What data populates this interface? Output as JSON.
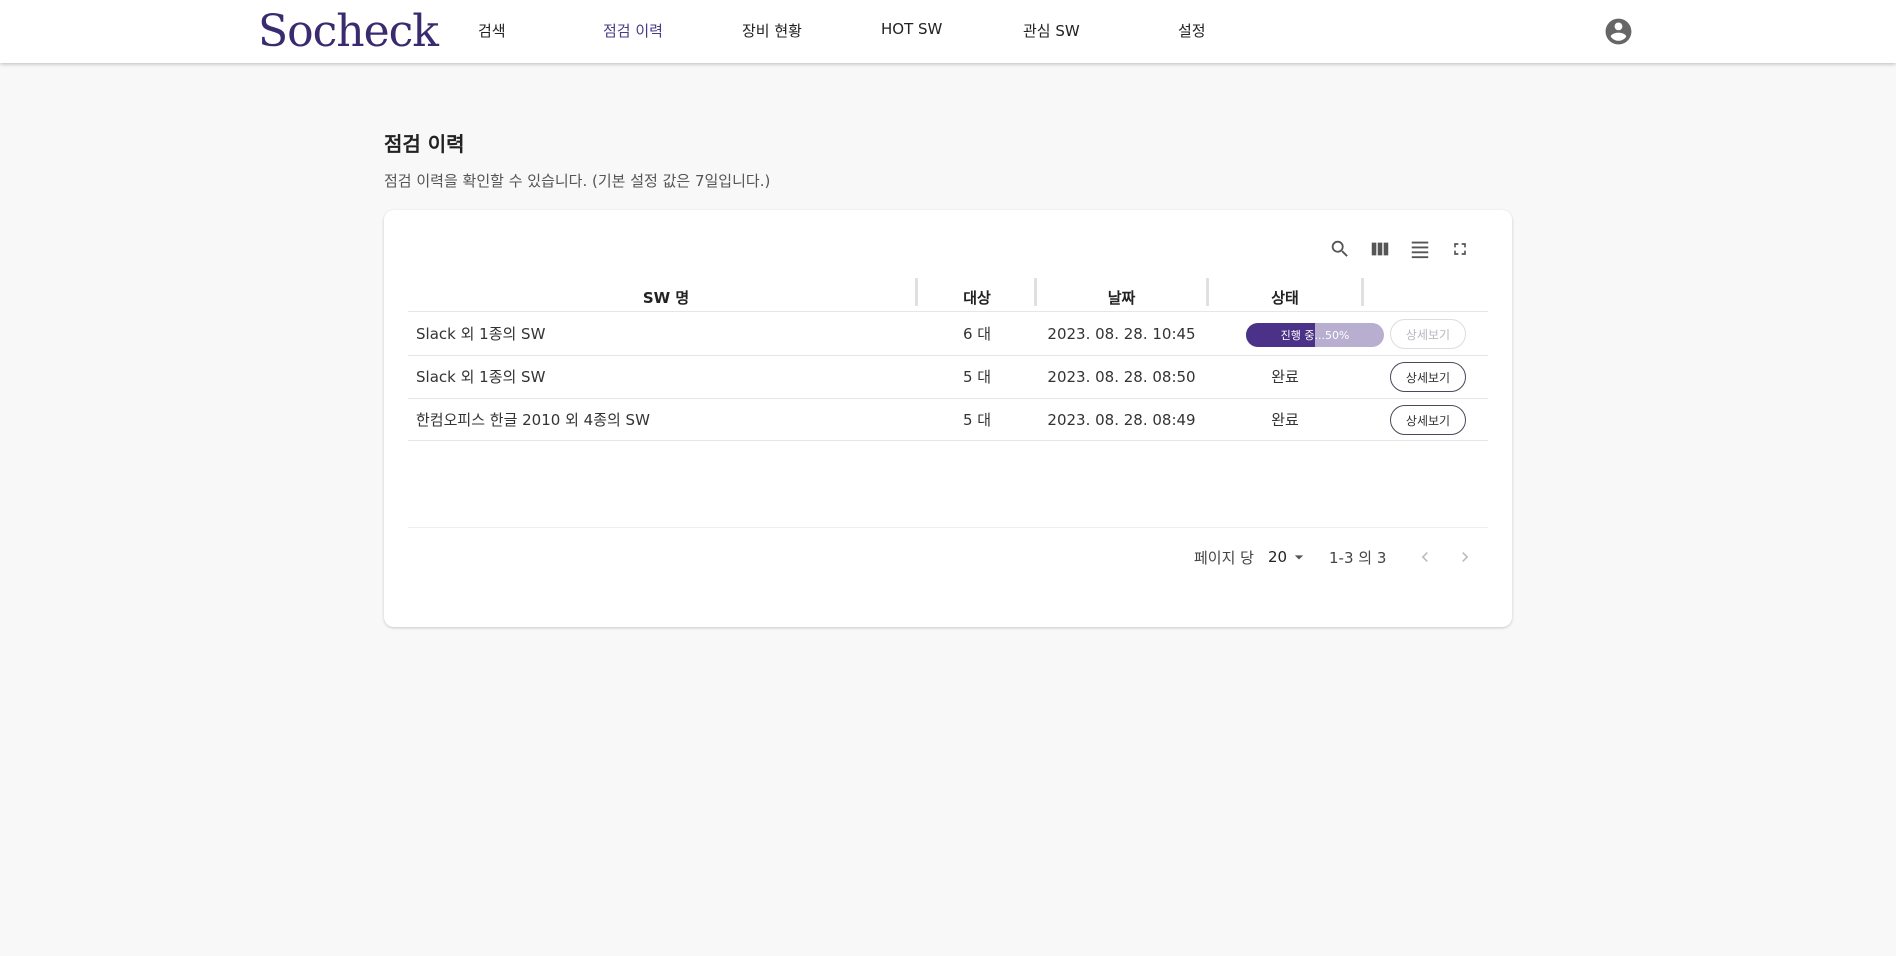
{
  "header": {
    "logo_text": "Socheck",
    "nav": [
      {
        "label": "검색"
      },
      {
        "label": "점검 이력"
      },
      {
        "label": "장비 현황"
      },
      {
        "label": "HOT SW"
      },
      {
        "label": "관심 SW"
      },
      {
        "label": "설정"
      }
    ],
    "active_index": 1,
    "account_icon": "account-circle-icon"
  },
  "main": {
    "title": "점검 이력",
    "description": "점검 이력을 확인할 수 있습니다. (기본 설정 값은 7일입니다.)"
  },
  "table": {
    "toolbar_icons": [
      "search-icon",
      "columns-icon",
      "density-icon",
      "fullscreen-icon"
    ],
    "columns": [
      "SW 명",
      "대상",
      "날짜",
      "상태",
      ""
    ],
    "rows": [
      {
        "name": "Slack 외 1종의 SW",
        "target": "6 대",
        "date": "2023. 08. 28. 10:45",
        "status": "진행 중...50%",
        "progress": 0.5,
        "in_progress": true,
        "action": "상세보기",
        "action_enabled": false
      },
      {
        "name": "Slack 외 1종의 SW",
        "target": "5 대",
        "date": "2023. 08. 28. 08:50",
        "status": "완료",
        "in_progress": false,
        "action": "상세보기",
        "action_enabled": true
      },
      {
        "name": "한컴오피스 한글 2010 외 4종의 SW",
        "target": "5 대",
        "date": "2023. 08. 28. 08:49",
        "status": "완료",
        "in_progress": false,
        "action": "상세보기",
        "action_enabled": true
      }
    ],
    "pagination": {
      "rows_per_page_label": "페이지 당",
      "rows_per_page": "20",
      "range": "1-3 의 3"
    }
  },
  "colors": {
    "brand": "#3a2a70",
    "accent_red": "#d0202a",
    "progress_fill": "#4b3288",
    "progress_track": "#b7aed0",
    "background": "#f8f8f9"
  }
}
